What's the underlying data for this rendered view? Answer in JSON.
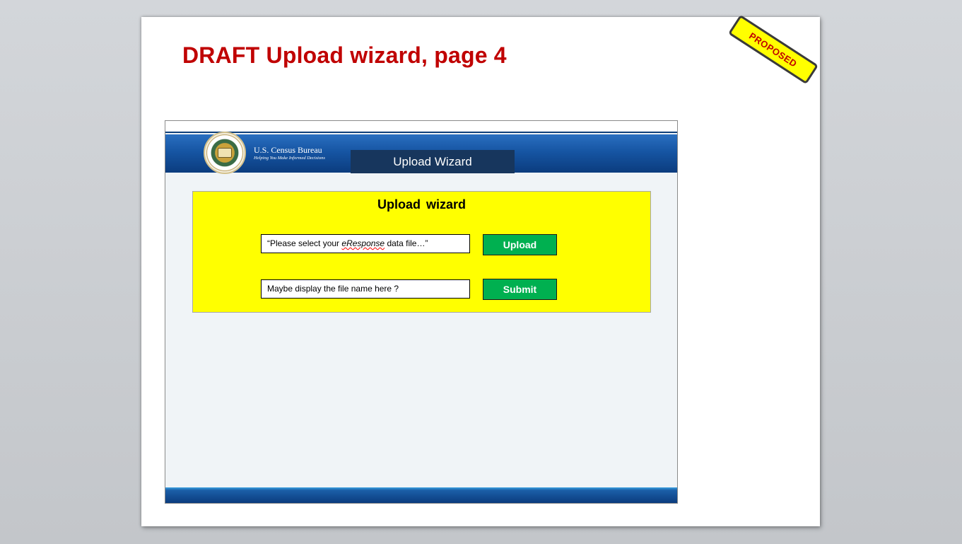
{
  "slide": {
    "title": "DRAFT Upload wizard, page 4",
    "stamp": "PROPOSED"
  },
  "header": {
    "agency_name": "U.S. Census Bureau",
    "agency_tagline": "Helping You Make Informed Decisions",
    "tab_label": "Upload Wizard"
  },
  "wizard": {
    "heading": "Upload wizard",
    "file_prompt": {
      "prefix": "“Please select your ",
      "emphasis": "eResponse",
      "suffix": " data file…”"
    },
    "filename_hint": "Maybe display the file name here ?",
    "upload_label": "Upload",
    "submit_label": "Submit"
  },
  "colors": {
    "title_red": "#c00000",
    "panel_yellow": "#ffff00",
    "button_green": "#00b050",
    "header_blue": "#1655a3",
    "tab_navy": "#17365d"
  },
  "icons": {
    "seal": "census-bureau-seal-icon"
  }
}
